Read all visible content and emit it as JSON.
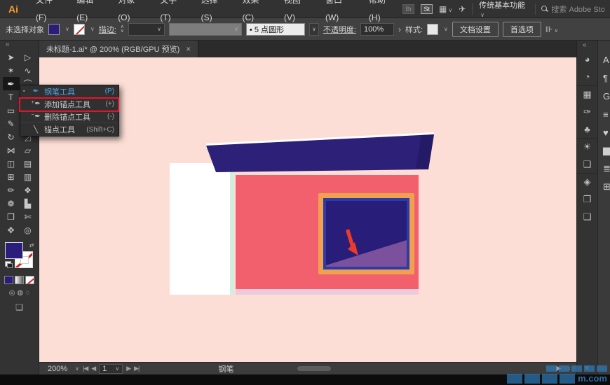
{
  "menubar": {
    "logo": "Ai",
    "items": [
      {
        "name": "menu-file",
        "label": "文件(F)"
      },
      {
        "name": "menu-edit",
        "label": "编辑(E)"
      },
      {
        "name": "menu-object",
        "label": "对象(O)"
      },
      {
        "name": "menu-type",
        "label": "文字(T)"
      },
      {
        "name": "menu-select",
        "label": "选择(S)"
      },
      {
        "name": "menu-effect",
        "label": "效果(C)"
      },
      {
        "name": "menu-view",
        "label": "视图(V)"
      },
      {
        "name": "menu-window",
        "label": "窗口(W)"
      },
      {
        "name": "menu-help",
        "label": "帮助(H)"
      }
    ],
    "br_badge": "Br",
    "st_badge": "St",
    "workspace": "传统基本功能",
    "search_text": "搜索 Adobe Stoc"
  },
  "controlbar": {
    "no_selection": "未选择对象",
    "stroke_label": "描边:",
    "brush": "•  5 点圆形",
    "opacity_label": "不透明度:",
    "opacity_value": "100%",
    "style_label": "样式:",
    "doc_setup": "文档设置",
    "preferences": "首选项"
  },
  "tab": {
    "title": "未标题-1.ai* @ 200% (RGB/GPU 预览)",
    "close": "×"
  },
  "toolbar": {
    "collapse": "«",
    "tools": [
      {
        "name": "selection-tool",
        "glyph": "➤"
      },
      {
        "name": "direct-selection-tool",
        "glyph": "▷"
      },
      {
        "name": "magic-wand-tool",
        "glyph": "✶"
      },
      {
        "name": "lasso-tool",
        "glyph": "∿"
      },
      {
        "name": "pen-tool",
        "glyph": "✒",
        "active": true
      },
      {
        "name": "curvature-tool",
        "glyph": "⌒"
      },
      {
        "name": "type-tool",
        "glyph": "T"
      },
      {
        "name": "line-segment-tool",
        "glyph": "╲"
      },
      {
        "name": "rectangle-tool",
        "glyph": "▭"
      },
      {
        "name": "paintbrush-tool",
        "glyph": "✑"
      },
      {
        "name": "pencil-tool",
        "glyph": "✎"
      },
      {
        "name": "scissors-tool",
        "glyph": "✂"
      },
      {
        "name": "rotate-tool",
        "glyph": "↻"
      },
      {
        "name": "scale-tool",
        "glyph": "◿"
      },
      {
        "name": "width-tool",
        "glyph": "⋈"
      },
      {
        "name": "free-transform-tool",
        "glyph": "▱"
      },
      {
        "name": "shape-builder-tool",
        "glyph": "◫"
      },
      {
        "name": "perspective-grid-tool",
        "glyph": "▤"
      },
      {
        "name": "mesh-tool",
        "glyph": "⊞"
      },
      {
        "name": "gradient-tool",
        "glyph": "▥"
      },
      {
        "name": "eyedropper-tool",
        "glyph": "✏"
      },
      {
        "name": "blend-tool",
        "glyph": "❖"
      },
      {
        "name": "symbol-sprayer-tool",
        "glyph": "❁"
      },
      {
        "name": "graph-tool",
        "glyph": "▙"
      },
      {
        "name": "artboard-tool",
        "glyph": "❐"
      },
      {
        "name": "slice-tool",
        "glyph": "✄"
      },
      {
        "name": "hand-tool",
        "glyph": "✥"
      },
      {
        "name": "zoom-tool",
        "glyph": "◎"
      }
    ],
    "modes": [
      "◎",
      "◍",
      "◌"
    ],
    "screen_mode": "❏"
  },
  "flyout": {
    "items": [
      {
        "name": "flyout-pen-tool",
        "ind": "▪",
        "glyph": "✒",
        "label": "钢笔工具",
        "shortcut": "(P)",
        "active": true
      },
      {
        "name": "flyout-add-anchor-tool",
        "ind": "",
        "glyph": "⁺✒",
        "label": "添加锚点工具",
        "shortcut": "(+)"
      },
      {
        "name": "flyout-delete-anchor-tool",
        "ind": "",
        "glyph": "⁻✒",
        "label": "删除锚点工具",
        "shortcut": "(-)"
      },
      {
        "name": "flyout-anchor-tool",
        "ind": "",
        "glyph": "╲",
        "label": "锚点工具",
        "shortcut": "(Shift+C)"
      }
    ]
  },
  "rightdock": {
    "collapse": "«",
    "icons": [
      {
        "name": "color-panel-icon",
        "glyph": "◕"
      },
      {
        "name": "color-guide-panel-icon",
        "glyph": "◔"
      },
      {
        "name": "swatches-panel-icon",
        "glyph": "▦",
        "divider": true
      },
      {
        "name": "brushes-panel-icon",
        "glyph": "✑"
      },
      {
        "name": "symbols-panel-icon",
        "glyph": "♣"
      },
      {
        "name": "appearance-panel-icon",
        "glyph": "☀",
        "divider": true
      },
      {
        "name": "graphic-styles-panel-icon",
        "glyph": "❑"
      },
      {
        "name": "layers-panel-icon",
        "glyph": "◈",
        "divider": true
      },
      {
        "name": "artboards-panel-icon",
        "glyph": "❒"
      },
      {
        "name": "asset-export-panel-icon",
        "glyph": "❏"
      }
    ],
    "more": "∨"
  },
  "fardock": {
    "icons": [
      {
        "name": "partial-panel-icon-a",
        "glyph": "A"
      },
      {
        "name": "partial-panel-icon-b",
        "glyph": "¶"
      },
      {
        "name": "partial-panel-icon-c",
        "glyph": "G"
      },
      {
        "name": "partial-panel-icon-d",
        "glyph": "≡"
      },
      {
        "name": "partial-panel-icon-e",
        "glyph": "♥"
      },
      {
        "name": "partial-panel-icon-f",
        "glyph": "▆"
      },
      {
        "name": "partial-panel-icon-g",
        "glyph": "≣"
      },
      {
        "name": "partial-panel-icon-h",
        "glyph": "⊞"
      }
    ]
  },
  "statusbar": {
    "zoom": "200%",
    "artboard": "1",
    "tool": "钢笔"
  },
  "icons": {
    "chevron_down": "∨",
    "stepper_up": "∧",
    "stepper_down": "∨",
    "arrange": "▦",
    "share": "✈",
    "align": "⊪",
    "more_arrow": "›",
    "first": "|◀",
    "prev": "◀",
    "next": "▶",
    "last": "▶|",
    "play": "▶",
    "back": "‹",
    "swap": "⇄"
  },
  "illustration": {
    "colors": {
      "canvas_bg": "#fcded6",
      "door": "#ffffff",
      "door_edge": "#d4eede",
      "wall": "#f2606e",
      "wall_shadow": "#eecbdc",
      "roof": "#2d2079",
      "roof_dark": "#241a66",
      "roof_highlight": "#ffffff",
      "window_frame": "#f0a150",
      "window_inner_frame": "#2c3ba6",
      "window_glass": "#281e79",
      "window_purple": "#7b509c",
      "arrow": "#ee3a28"
    }
  },
  "annotation": {
    "box_color": "#e8112d"
  },
  "watermark": {
    "tail": "m.com"
  }
}
